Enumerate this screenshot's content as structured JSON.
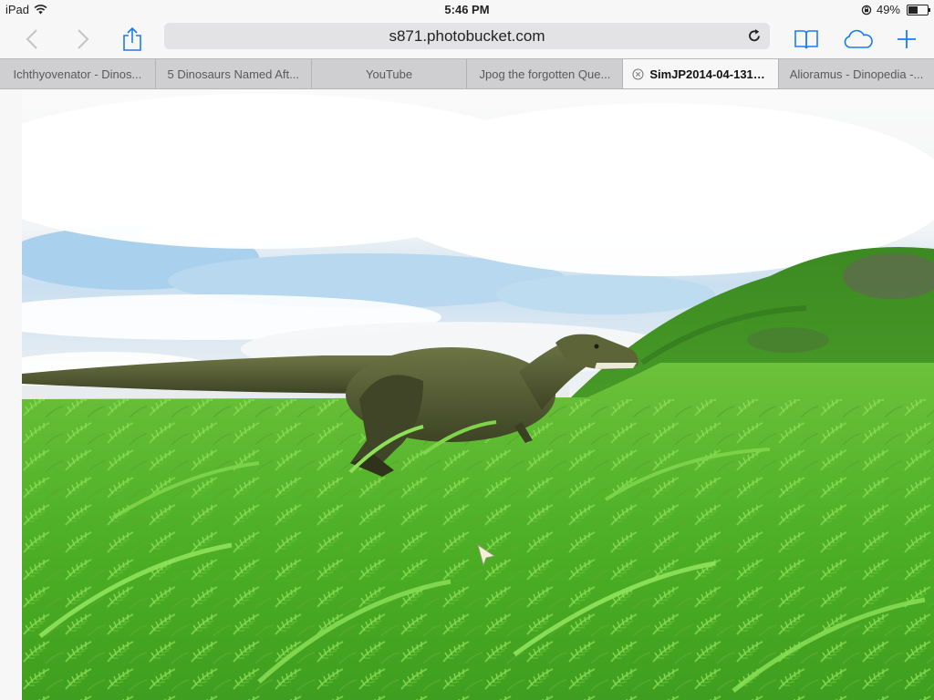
{
  "status_bar": {
    "device": "iPad",
    "time": "5:46 PM",
    "battery": "49%",
    "battery_level": 0.49
  },
  "toolbar": {
    "url": "s871.photobucket.com",
    "icons": {
      "back": "chevron-left-icon",
      "forward": "chevron-right-icon",
      "share": "share-icon",
      "reload": "reload-icon",
      "bookmarks": "book-icon",
      "icloud": "cloud-icon",
      "new_tab": "plus-icon"
    }
  },
  "tabs": [
    {
      "label": "Ichthyovenator - Dinos...",
      "active": false
    },
    {
      "label": "5 Dinosaurs Named Aft...",
      "active": false
    },
    {
      "label": "YouTube",
      "active": false
    },
    {
      "label": "Jpog the forgotten Que...",
      "active": false
    },
    {
      "label": "SimJP2014-04-1313...",
      "active": true
    },
    {
      "label": "Alioramus - Dinopedia -...",
      "active": false
    }
  ],
  "colors": {
    "chrome": "#f7f7f7",
    "tab_strip": "#cfcfd1",
    "url_field": "#e3e3e5",
    "accent": "#1a7cf5",
    "sky": "#9ccbe9",
    "grass": "#4fb82a",
    "dinosaur": "#545c34"
  }
}
